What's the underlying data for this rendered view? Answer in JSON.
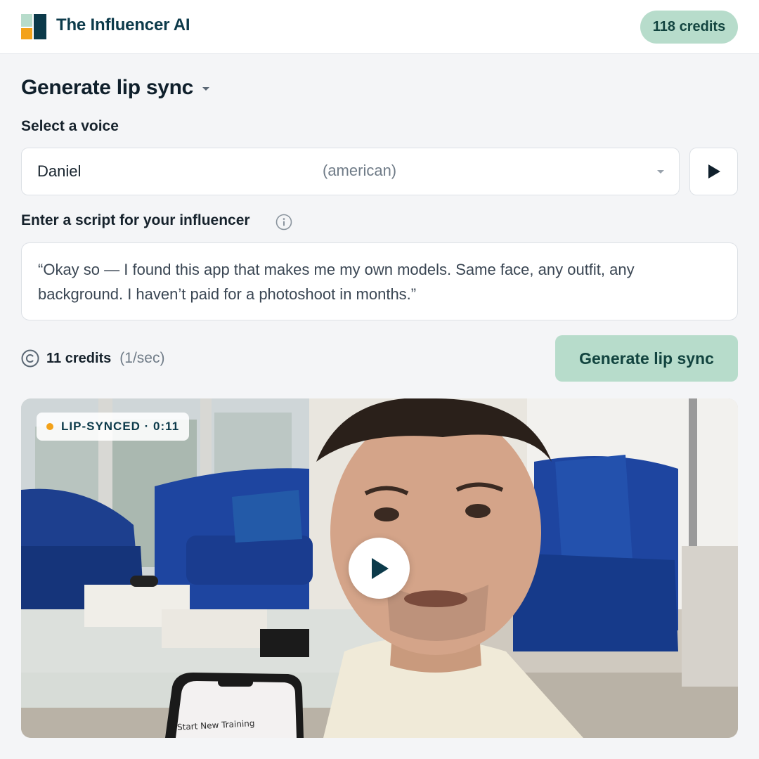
{
  "app": {
    "brand": "The Influencer AI",
    "credits_badge": "118 credits"
  },
  "colors": {
    "accent": "#b7dccb",
    "accent_text": "#12443f",
    "brand_text": "#0c3a4a",
    "status_dot": "#f3a21a"
  },
  "page": {
    "title": "Generate lip sync"
  },
  "voice": {
    "label": "Select a voice",
    "selected_name": "Daniel",
    "selected_accent": "(american)"
  },
  "script": {
    "label": "Enter a script for your influencer",
    "value": "“Okay so — I found this app that makes me my own models. Same face, any outfit, any background. I haven’t paid for a photoshoot in months.”"
  },
  "cost": {
    "credits": "11 credits",
    "rate": "(1/sec)"
  },
  "actions": {
    "generate_label": "Generate lip sync"
  },
  "video": {
    "status": "LIP-SYNCED · 0:11",
    "phone_screen_text": "Start New Training"
  },
  "icons": {
    "logo": "influencer-logo-icon",
    "title_dropdown": "chevron-down-icon",
    "select_dropdown": "chevron-down-icon",
    "play_voice": "play-icon",
    "info": "info-icon",
    "credits": "copyright-coin-icon",
    "video_play": "play-icon"
  }
}
